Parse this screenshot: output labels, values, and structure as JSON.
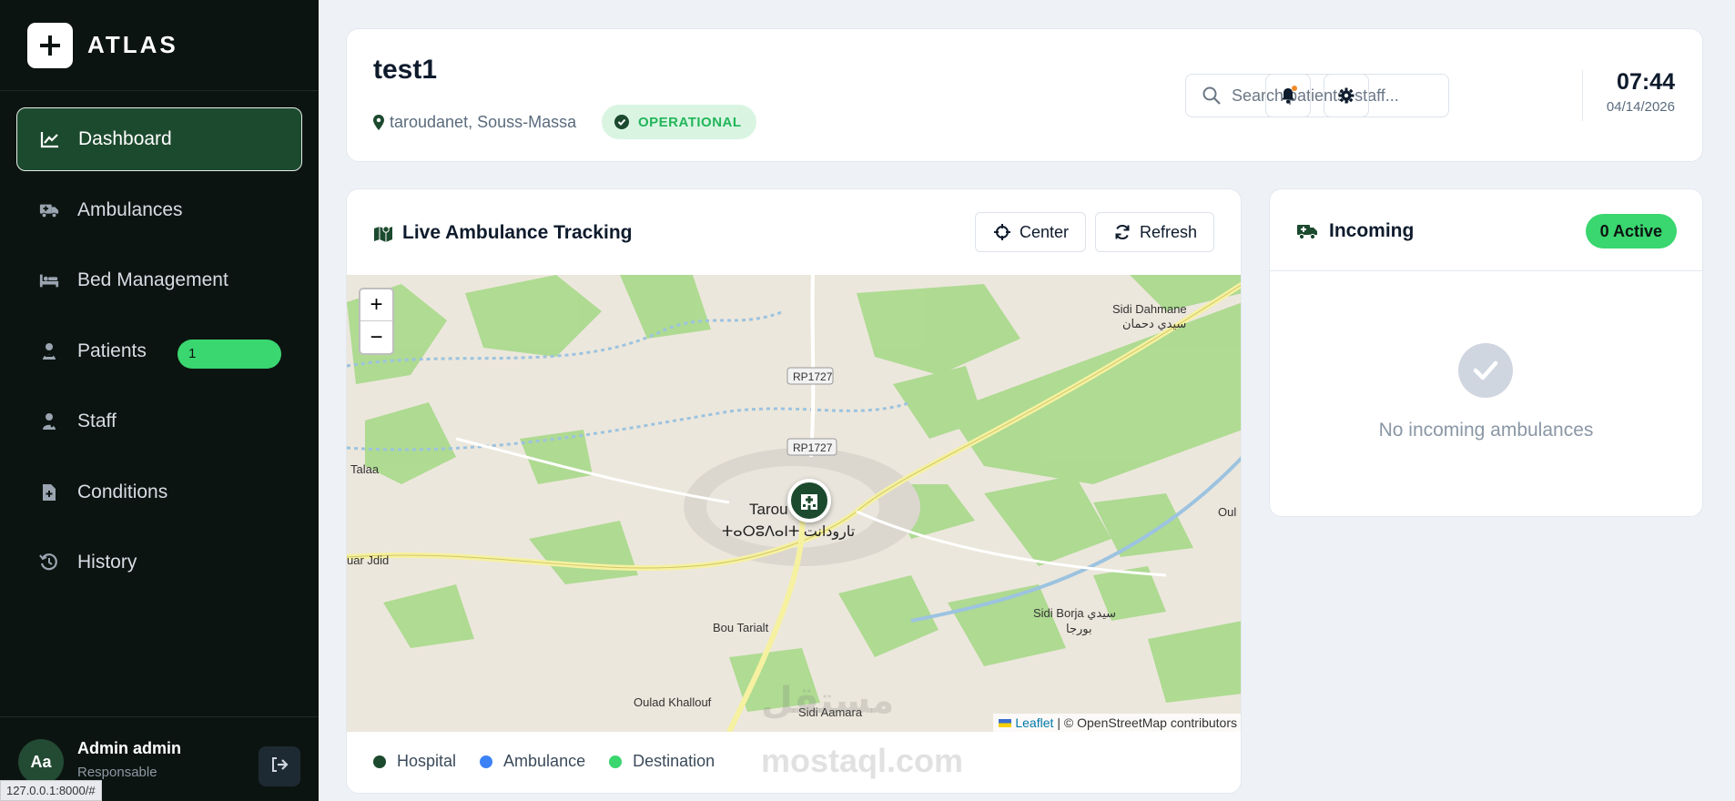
{
  "brand": {
    "name": "ATLAS",
    "logo_icon": "plus-icon"
  },
  "sidebar": {
    "items": [
      {
        "label": "Dashboard",
        "icon": "chart-line-icon",
        "active": true
      },
      {
        "label": "Ambulances",
        "icon": "ambulance-icon"
      },
      {
        "label": "Bed Management",
        "icon": "bed-icon"
      },
      {
        "label": "Patients",
        "icon": "patient-icon",
        "badge": "1"
      },
      {
        "label": "Staff",
        "icon": "user-doctor-icon"
      },
      {
        "label": "Conditions",
        "icon": "file-medical-icon"
      },
      {
        "label": "History",
        "icon": "history-icon"
      }
    ],
    "user": {
      "initials": "Aa",
      "name": "Admin admin",
      "role": "Responsable"
    },
    "url_hint": "127.0.0.1:8000/#"
  },
  "header": {
    "title": "test1",
    "location": "taroudanet, Souss-Massa",
    "status": "OPERATIONAL",
    "search_placeholder": "Search patients, staff...",
    "time": "07:44",
    "date": "04/14/2026"
  },
  "tracking": {
    "title": "Live Ambulance Tracking",
    "center_label": "Center",
    "refresh_label": "Refresh",
    "map": {
      "zoom_in": "+",
      "zoom_out": "−",
      "place_labels": [
        "Sidi Dahmane",
        "سيدي دحمان",
        "RP1727",
        "RP1727",
        "Talaa",
        "Tarou",
        "ⵜⴰⵔⵓⴷⴰⵏⵜ تارودانت",
        "uar Jdid",
        "Oul",
        "Sidi Borja سيدي",
        "بورجا",
        "Bou Tarialt",
        "Oulad Khallouf",
        "Sidi Aamara"
      ],
      "attribution_link": "Leaflet",
      "attribution_text": "| © OpenStreetMap contributors"
    },
    "legend": [
      {
        "label": "Hospital",
        "color": "#1c4a2e"
      },
      {
        "label": "Ambulance",
        "color": "#3b82f6"
      },
      {
        "label": "Destination",
        "color": "#3ad66f"
      }
    ]
  },
  "incoming": {
    "title": "Incoming",
    "active_badge": "0 Active",
    "empty_text": "No incoming ambulances"
  },
  "watermark": {
    "line1": "مستقل",
    "line2": "mostaql.com"
  },
  "colors": {
    "accent": "#3ad66f",
    "sidebar_bg": "#0c1411",
    "active_nav": "#1c4a2e"
  }
}
